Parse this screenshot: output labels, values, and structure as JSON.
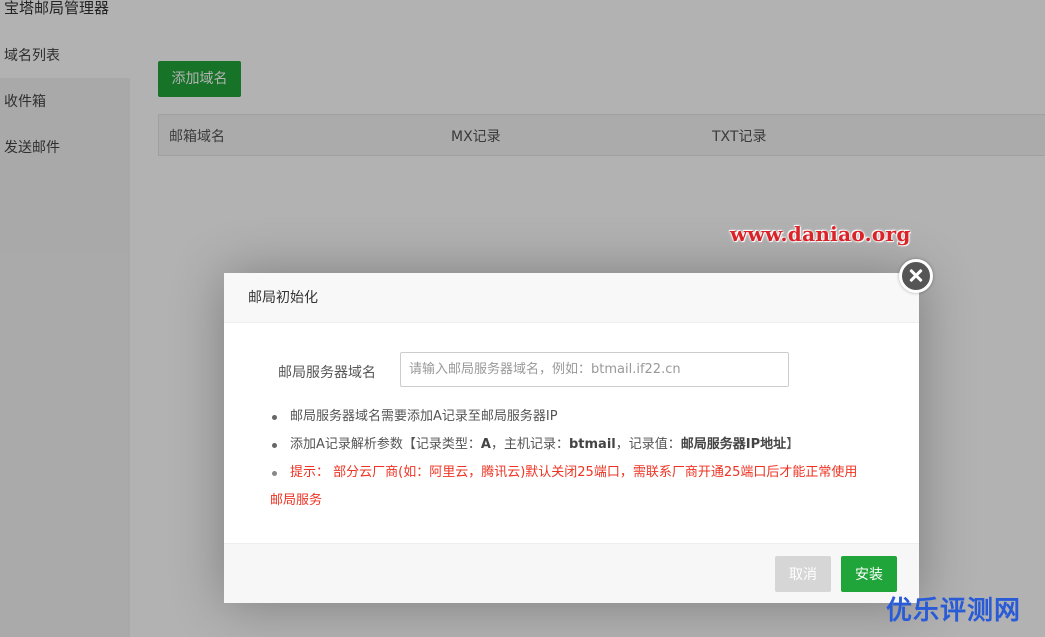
{
  "app": {
    "title": "宝塔邮局管理器",
    "sidebar": {
      "items": [
        {
          "label": "域名列表"
        },
        {
          "label": "收件箱"
        },
        {
          "label": "发送邮件"
        }
      ]
    },
    "add_domain_label": "添加域名",
    "table": {
      "columns": [
        "邮箱域名",
        "MX记录",
        "TXT记录"
      ]
    }
  },
  "modal": {
    "title": "邮局初始化",
    "field_label": "邮局服务器域名",
    "field_value": "",
    "field_placeholder": "请输入邮局服务器域名，例如：btmail.if22.cn",
    "tips": {
      "tip1": "邮局服务器域名需要添加A记录至邮局服务器IP",
      "tip2_prefix": "添加A记录解析参数【记录类型：",
      "tip2_type": "A",
      "tip2_mid1": "，主机记录：",
      "tip2_host": "btmail",
      "tip2_mid2": "，记录值：",
      "tip2_value": "邮局服务器IP地址",
      "tip2_suffix": "】",
      "tip3": "提示： 部分云厂商(如：阿里云，腾讯云)默认关闭25端口，需联系厂商开通25端口后才能正常使用邮局服务"
    },
    "cancel_label": "取消",
    "install_label": "安装"
  },
  "watermarks": {
    "top": "www.daniao.org",
    "bottom": "优乐评测网"
  },
  "colors": {
    "primary_green": "#20a53a",
    "warning_red": "#e32",
    "watermark_red": "#e0242a",
    "watermark_blue": "#2a5bd7"
  }
}
